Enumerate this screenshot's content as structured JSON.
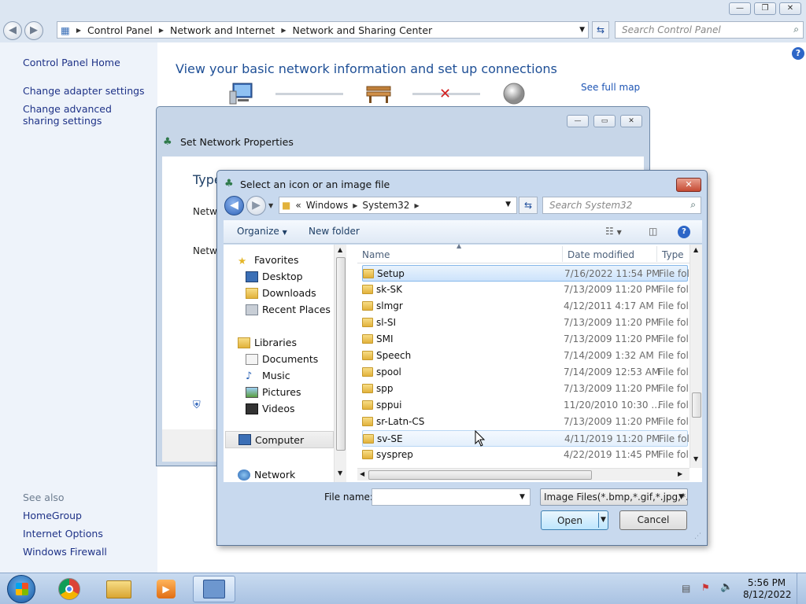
{
  "control_panel": {
    "breadcrumb": [
      "Control Panel",
      "Network and Internet",
      "Network and Sharing Center"
    ],
    "search_placeholder": "Search Control Panel",
    "sidebar": {
      "home": "Control Panel Home",
      "links": [
        "Change adapter settings",
        "Change advanced sharing settings"
      ],
      "see_also_label": "See also",
      "see_also": [
        "HomeGroup",
        "Internet Options",
        "Windows Firewall"
      ]
    },
    "heading": "View your basic network information and set up connections",
    "see_full_map": "See full map"
  },
  "snp_window": {
    "title": "Set Network Properties",
    "partial_heading": "Type",
    "partial_line1": "Netw",
    "partial_line2": "Netw"
  },
  "dialog": {
    "title": "Select an icon or an image file",
    "breadcrumb": [
      "Windows",
      "System32"
    ],
    "search_placeholder": "Search System32",
    "toolbar": {
      "organize": "Organize",
      "new_folder": "New folder"
    },
    "nav": {
      "favorites": "Favorites",
      "favorites_items": [
        "Desktop",
        "Downloads",
        "Recent Places"
      ],
      "libraries": "Libraries",
      "libraries_items": [
        "Documents",
        "Music",
        "Pictures",
        "Videos"
      ],
      "computer": "Computer",
      "network": "Network"
    },
    "columns": {
      "name": "Name",
      "date": "Date modified",
      "type": "Type"
    },
    "files": [
      {
        "name": "Setup",
        "date": "7/16/2022 11:54 PM",
        "type": "File folder"
      },
      {
        "name": "sk-SK",
        "date": "7/13/2009 11:20 PM",
        "type": "File folder"
      },
      {
        "name": "slmgr",
        "date": "4/12/2011 4:17 AM",
        "type": "File folder"
      },
      {
        "name": "sl-SI",
        "date": "7/13/2009 11:20 PM",
        "type": "File folder"
      },
      {
        "name": "SMI",
        "date": "7/13/2009 11:20 PM",
        "type": "File folder"
      },
      {
        "name": "Speech",
        "date": "7/14/2009 1:32 AM",
        "type": "File folder"
      },
      {
        "name": "spool",
        "date": "7/14/2009 12:53 AM",
        "type": "File folder"
      },
      {
        "name": "spp",
        "date": "7/13/2009 11:20 PM",
        "type": "File folder"
      },
      {
        "name": "sppui",
        "date": "11/20/2010 10:30 ...",
        "type": "File folder"
      },
      {
        "name": "sr-Latn-CS",
        "date": "7/13/2009 11:20 PM",
        "type": "File folder"
      },
      {
        "name": "sv-SE",
        "date": "4/11/2019 11:20 PM",
        "type": "File folder"
      },
      {
        "name": "sysprep",
        "date": "4/22/2019 11:45 PM",
        "type": "File folder"
      }
    ],
    "file_name_label": "File name:",
    "file_name_value": "",
    "filter": "Image Files(*.bmp,*.gif,*.jpg,*.png)",
    "open": "Open",
    "cancel": "Cancel"
  },
  "taskbar": {
    "time": "5:56 PM",
    "date": "8/12/2022"
  },
  "colors": {
    "link": "#1e3287",
    "heading": "#1e4f96",
    "selection": "#cde3fb",
    "close_red": "#c54a33"
  }
}
